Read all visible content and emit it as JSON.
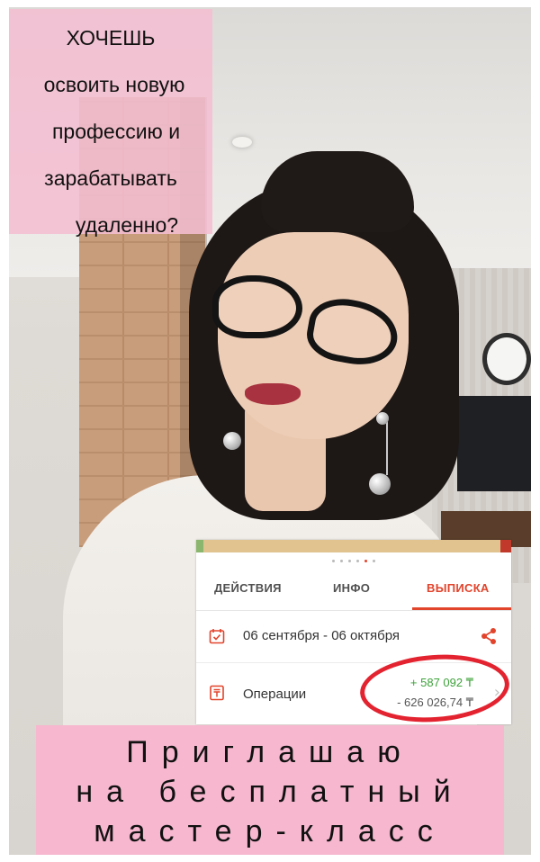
{
  "promo": {
    "headline": [
      "ХОЧЕШЬ",
      "освоить новую",
      "профессию и",
      "зарабатывать",
      "удаленно?"
    ],
    "cta": [
      "Приглашаю",
      "на бесплатный",
      "мастер-класс"
    ]
  },
  "app": {
    "tabs": [
      "ДЕЙСТВИЯ",
      "ИНФО",
      "ВЫПИСКА"
    ],
    "active_tab": "ВЫПИСКА",
    "period": "06 сентября - 06 октября",
    "operations_label": "Операции",
    "income": "+ 587 092 ₸",
    "expense": "- 626 026,74 ₸",
    "pager_count": 6,
    "pager_active": 5
  },
  "colors": {
    "promo_pink": "#f6b7cf",
    "accent_red": "#e2432b",
    "income_green": "#3da33a",
    "circle_red": "#e3232f"
  }
}
